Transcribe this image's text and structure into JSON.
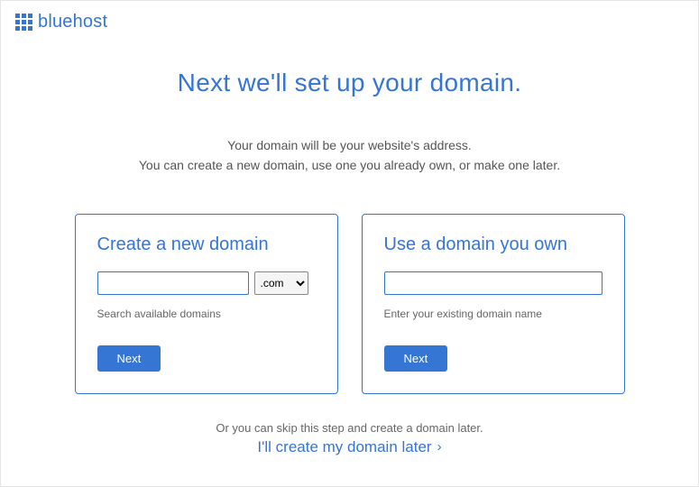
{
  "brand": {
    "name": "bluehost"
  },
  "page": {
    "title": "Next we'll set up your domain.",
    "subtitle_line1": "Your domain will be your website's address.",
    "subtitle_line2": "You can create a new domain, use one you already own, or make one later."
  },
  "card_new": {
    "title": "Create a new domain",
    "input_value": "",
    "tld_selected": ".com",
    "helper": "Search available domains",
    "button": "Next"
  },
  "card_own": {
    "title": "Use a domain you own",
    "input_value": "",
    "helper": "Enter your existing domain name",
    "button": "Next"
  },
  "skip": {
    "prompt": "Or you can skip this step and create a domain later.",
    "link": "I'll create my domain later"
  }
}
